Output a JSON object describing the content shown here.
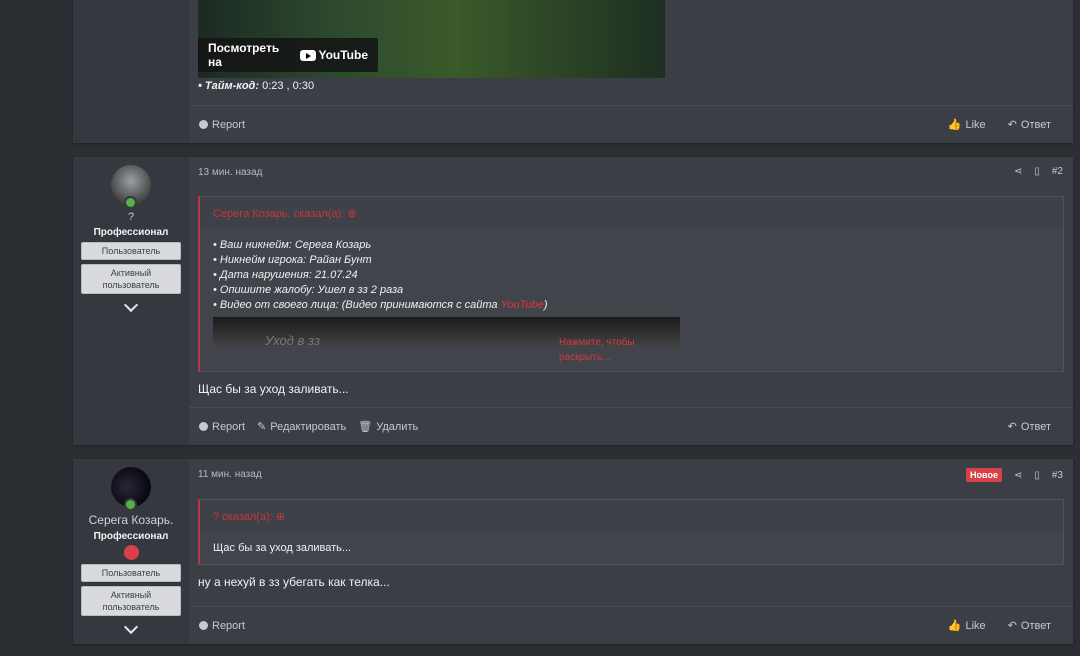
{
  "post1": {
    "video_button": "Посмотреть на",
    "video_brand": "YouTube",
    "timecode_label": "• Тайм-код:",
    "timecode_value": "0:23 , 0:30",
    "footer": {
      "report": "Report",
      "like": "Like",
      "reply": "Ответ"
    }
  },
  "post2": {
    "user": {
      "name": "?",
      "title": "Профессионал",
      "badges": [
        "Пользователь",
        "Активный пользователь"
      ]
    },
    "time": "13 мин. назад",
    "number": "#2",
    "quote": {
      "head": "Серега Козарь. сказал(а):",
      "lines": [
        "• Ваш никнейм: Серега Козарь",
        "• Никнейм игрока: Райан Бунт",
        "• Дата нарушения: 21.07.24",
        "• Опишите жалобу: Ушел в зз 2 раза",
        "• Видео от своего лица: (Видео принимаются с сайта "
      ],
      "youtube_link": "YouTube",
      "close_paren": ")",
      "embed_title": "Уход в зз",
      "expand_text": "Нажмите, чтобы раскрыть..."
    },
    "body": "Щас бы за уход заливать...",
    "footer": {
      "report": "Report",
      "edit": "Редактировать",
      "delete": "Удалить",
      "reply": "Ответ"
    }
  },
  "post3": {
    "user": {
      "name": "Серега Козарь.",
      "title": "Профессионал",
      "badges": [
        "Пользователь",
        "Активный пользователь"
      ]
    },
    "time": "11 мин. назад",
    "new_label": "Новое",
    "number": "#3",
    "quote": {
      "head": "? сказал(а):",
      "body": "Щас бы за уход заливать..."
    },
    "body": "ну а нехуй в зз убегать как телка...",
    "footer": {
      "report": "Report",
      "like": "Like",
      "reply": "Ответ"
    }
  },
  "colors": {
    "accent_red": "#d9414a",
    "online": "#58b048",
    "background": "#2b2e33"
  }
}
